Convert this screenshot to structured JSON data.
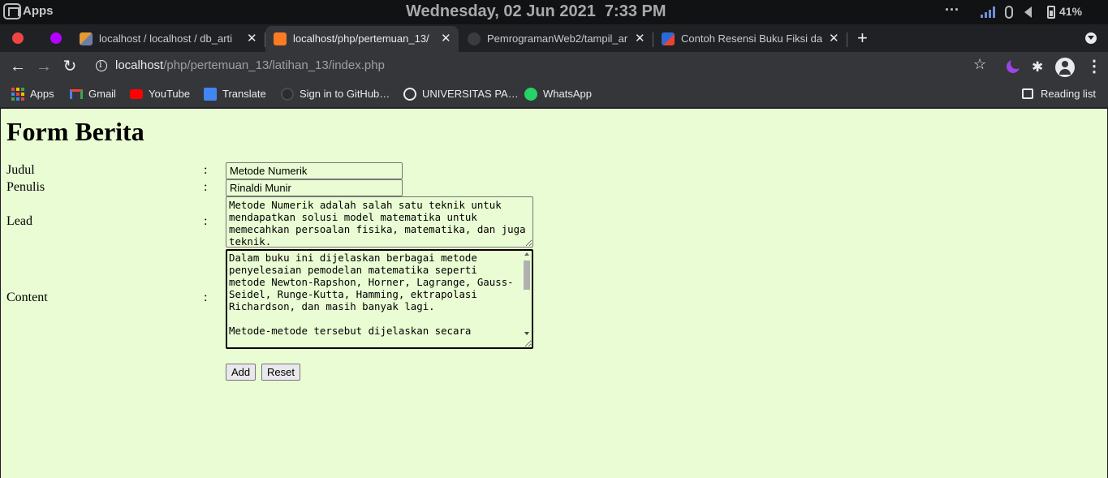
{
  "os": {
    "apps_label": "Apps",
    "clock": "Wednesday, 02 Jun 2021  7:33 PM",
    "more": "···",
    "battery": "41%"
  },
  "tabs": [
    {
      "title": "localhost / localhost / db_arti",
      "favicon": "phpmyadmin-icon",
      "active": false
    },
    {
      "title": "localhost/php/pertemuan_13/",
      "favicon": "xampp-icon",
      "active": true
    },
    {
      "title": "PemrogramanWeb2/tampil_ar",
      "favicon": "github-icon",
      "active": false
    },
    {
      "title": "Contoh Resensi Buku Fiksi dan",
      "favicon": "blog-icon",
      "active": false
    }
  ],
  "tab_close": "✕",
  "new_tab": "+",
  "address": {
    "host": "localhost",
    "path": "/php/pertemuan_13/latihan_13/index.php"
  },
  "bookmarks": [
    {
      "label": "Apps",
      "icon": "apps-grid-icon"
    },
    {
      "label": "Gmail",
      "icon": "gmail-icon"
    },
    {
      "label": "YouTube",
      "icon": "youtube-icon"
    },
    {
      "label": "Translate",
      "icon": "translate-icon"
    },
    {
      "label": "Sign in to GitHub…",
      "icon": "github-icon"
    },
    {
      "label": "UNIVERSITAS PA…",
      "icon": "globe-icon"
    },
    {
      "label": "WhatsApp",
      "icon": "whatsapp-icon"
    }
  ],
  "reading_list": "Reading list",
  "form": {
    "heading": "Form Berita",
    "colon": ":",
    "judul_label": "Judul",
    "judul_value": "Metode Numerik",
    "penulis_label": "Penulis",
    "penulis_value": "Rinaldi Munir",
    "lead_label": "Lead",
    "lead_value": "Metode Numerik adalah salah satu teknik untuk mendapatkan solusi model matematika untuk memecahkan persoalan fisika, matematika, dan juga teknik.",
    "content_label": "Content",
    "content_value": "Dalam buku ini dijelaskan berbagai metode penyelesaian pemodelan matematika seperti metode Newton-Rapshon, Horner, Lagrange, Gauss-Seidel, Runge-Kutta, Hamming, ektrapolasi Richardson, dan masih banyak lagi.\n\nMetode-metode tersebut dijelaskan secara",
    "add_label": "Add",
    "reset_label": "Reset"
  },
  "colors": {
    "page_bg": "#e9fcd3",
    "chrome_dark": "#202124",
    "chrome_toolbar": "#35363a"
  }
}
